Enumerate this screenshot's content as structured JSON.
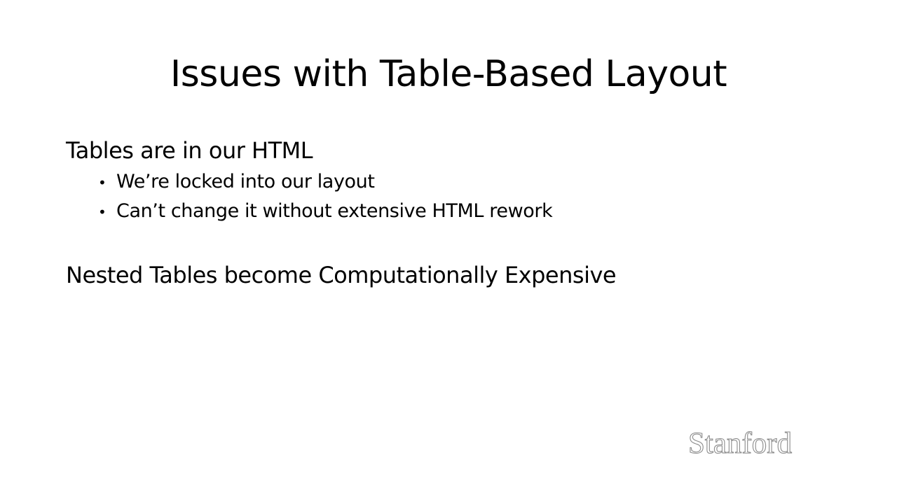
{
  "slide": {
    "title": "Issues with Table-Based Layout",
    "section_1": {
      "heading": "Tables are in our HTML",
      "bullets": [
        {
          "marker": "•",
          "text": "We’re locked into our layout"
        },
        {
          "marker": "•",
          "text": "Can’t change it without extensive HTML rework"
        }
      ]
    },
    "section_2": {
      "heading": "Nested Tables become Computationally Expensive"
    },
    "logo": {
      "text": "Stanford",
      "stroke_color": "#8c8c8c",
      "fill_color": "#ffffff"
    }
  }
}
